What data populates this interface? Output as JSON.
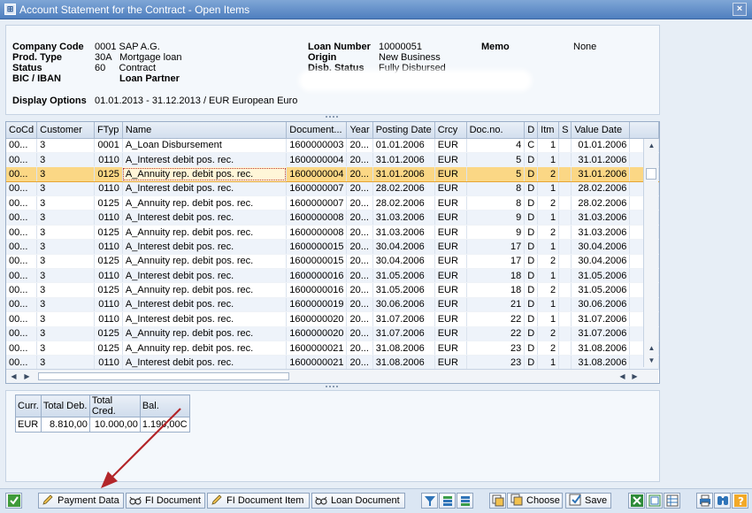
{
  "window": {
    "title": "Account Statement for the Contract - Open Items",
    "close_label": "×"
  },
  "header": {
    "company_code_label": "Company Code",
    "company_code_value": "0001 SAP A.G.",
    "prod_type_label": "Prod. Type",
    "prod_type_value": "30A   Mortgage loan",
    "status_label": "Status",
    "status_value": "60     Contract",
    "bic_label": "BIC / IBAN",
    "loan_partner_label": "Loan Partner",
    "display_options_label": "Display Options",
    "display_options_value": "01.01.2013 - 31.12.2013 / EUR European Euro",
    "loan_number_label": "Loan Number",
    "loan_number_value": "10000051",
    "origin_label": "Origin",
    "origin_value": "New Business",
    "disb_status_label": "Disb. Status",
    "disb_status_value": "Fully Disbursed",
    "memo_label": "Memo",
    "memo_value": "None"
  },
  "table": {
    "columns": [
      "CoCd",
      "Customer",
      "FTyp",
      "Name",
      "Document...",
      "Year",
      "Posting Date",
      "Crcy",
      "Doc.no.",
      "D",
      "Itm",
      "S",
      "Value Date"
    ],
    "rows": [
      [
        "00...",
        "3",
        "0001",
        "A_Loan Disbursement",
        "1600000003",
        "20...",
        "01.01.2006",
        "EUR",
        "4",
        "C",
        "1",
        "",
        "01.01.2006"
      ],
      [
        "00...",
        "3",
        "0110",
        "A_Interest debit pos. rec.",
        "1600000004",
        "20...",
        "31.01.2006",
        "EUR",
        "5",
        "D",
        "1",
        "",
        "31.01.2006"
      ],
      [
        "00...",
        "3",
        "0125",
        "A_Annuity rep. debit pos. rec.",
        "1600000004",
        "20...",
        "31.01.2006",
        "EUR",
        "5",
        "D",
        "2",
        "",
        "31.01.2006"
      ],
      [
        "00...",
        "3",
        "0110",
        "A_Interest debit pos. rec.",
        "1600000007",
        "20...",
        "28.02.2006",
        "EUR",
        "8",
        "D",
        "1",
        "",
        "28.02.2006"
      ],
      [
        "00...",
        "3",
        "0125",
        "A_Annuity rep. debit pos. rec.",
        "1600000007",
        "20...",
        "28.02.2006",
        "EUR",
        "8",
        "D",
        "2",
        "",
        "28.02.2006"
      ],
      [
        "00...",
        "3",
        "0110",
        "A_Interest debit pos. rec.",
        "1600000008",
        "20...",
        "31.03.2006",
        "EUR",
        "9",
        "D",
        "1",
        "",
        "31.03.2006"
      ],
      [
        "00...",
        "3",
        "0125",
        "A_Annuity rep. debit pos. rec.",
        "1600000008",
        "20...",
        "31.03.2006",
        "EUR",
        "9",
        "D",
        "2",
        "",
        "31.03.2006"
      ],
      [
        "00...",
        "3",
        "0110",
        "A_Interest debit pos. rec.",
        "1600000015",
        "20...",
        "30.04.2006",
        "EUR",
        "17",
        "D",
        "1",
        "",
        "30.04.2006"
      ],
      [
        "00...",
        "3",
        "0125",
        "A_Annuity rep. debit pos. rec.",
        "1600000015",
        "20...",
        "30.04.2006",
        "EUR",
        "17",
        "D",
        "2",
        "",
        "30.04.2006"
      ],
      [
        "00...",
        "3",
        "0110",
        "A_Interest debit pos. rec.",
        "1600000016",
        "20...",
        "31.05.2006",
        "EUR",
        "18",
        "D",
        "1",
        "",
        "31.05.2006"
      ],
      [
        "00...",
        "3",
        "0125",
        "A_Annuity rep. debit pos. rec.",
        "1600000016",
        "20...",
        "31.05.2006",
        "EUR",
        "18",
        "D",
        "2",
        "",
        "31.05.2006"
      ],
      [
        "00...",
        "3",
        "0110",
        "A_Interest debit pos. rec.",
        "1600000019",
        "20...",
        "30.06.2006",
        "EUR",
        "21",
        "D",
        "1",
        "",
        "30.06.2006"
      ],
      [
        "00...",
        "3",
        "0110",
        "A_Interest debit pos. rec.",
        "1600000020",
        "20...",
        "31.07.2006",
        "EUR",
        "22",
        "D",
        "1",
        "",
        "31.07.2006"
      ],
      [
        "00...",
        "3",
        "0125",
        "A_Annuity rep. debit pos. rec.",
        "1600000020",
        "20...",
        "31.07.2006",
        "EUR",
        "22",
        "D",
        "2",
        "",
        "31.07.2006"
      ],
      [
        "00...",
        "3",
        "0125",
        "A_Annuity rep. debit pos. rec.",
        "1600000021",
        "20...",
        "31.08.2006",
        "EUR",
        "23",
        "D",
        "2",
        "",
        "31.08.2006"
      ],
      [
        "00...",
        "3",
        "0110",
        "A_Interest debit pos. rec.",
        "1600000021",
        "20...",
        "31.08.2006",
        "EUR",
        "23",
        "D",
        "1",
        "",
        "31.08.2006"
      ]
    ]
  },
  "totals": {
    "columns": [
      "Curr.",
      "Total Deb.",
      "Total Cred.",
      "Bal."
    ],
    "row": [
      "EUR",
      "8.810,00",
      "10.000,00",
      "1.190,00C"
    ]
  },
  "toolbar": {
    "payment_data": "Payment Data",
    "fi_document": "FI Document",
    "fi_document_item": "FI Document Item",
    "loan_document": "Loan Document",
    "choose": "Choose",
    "save": "Save"
  },
  "colors": {
    "accent": "#4f7fbf",
    "selected_row": "#fbd785",
    "arrow": "#b3262a"
  }
}
